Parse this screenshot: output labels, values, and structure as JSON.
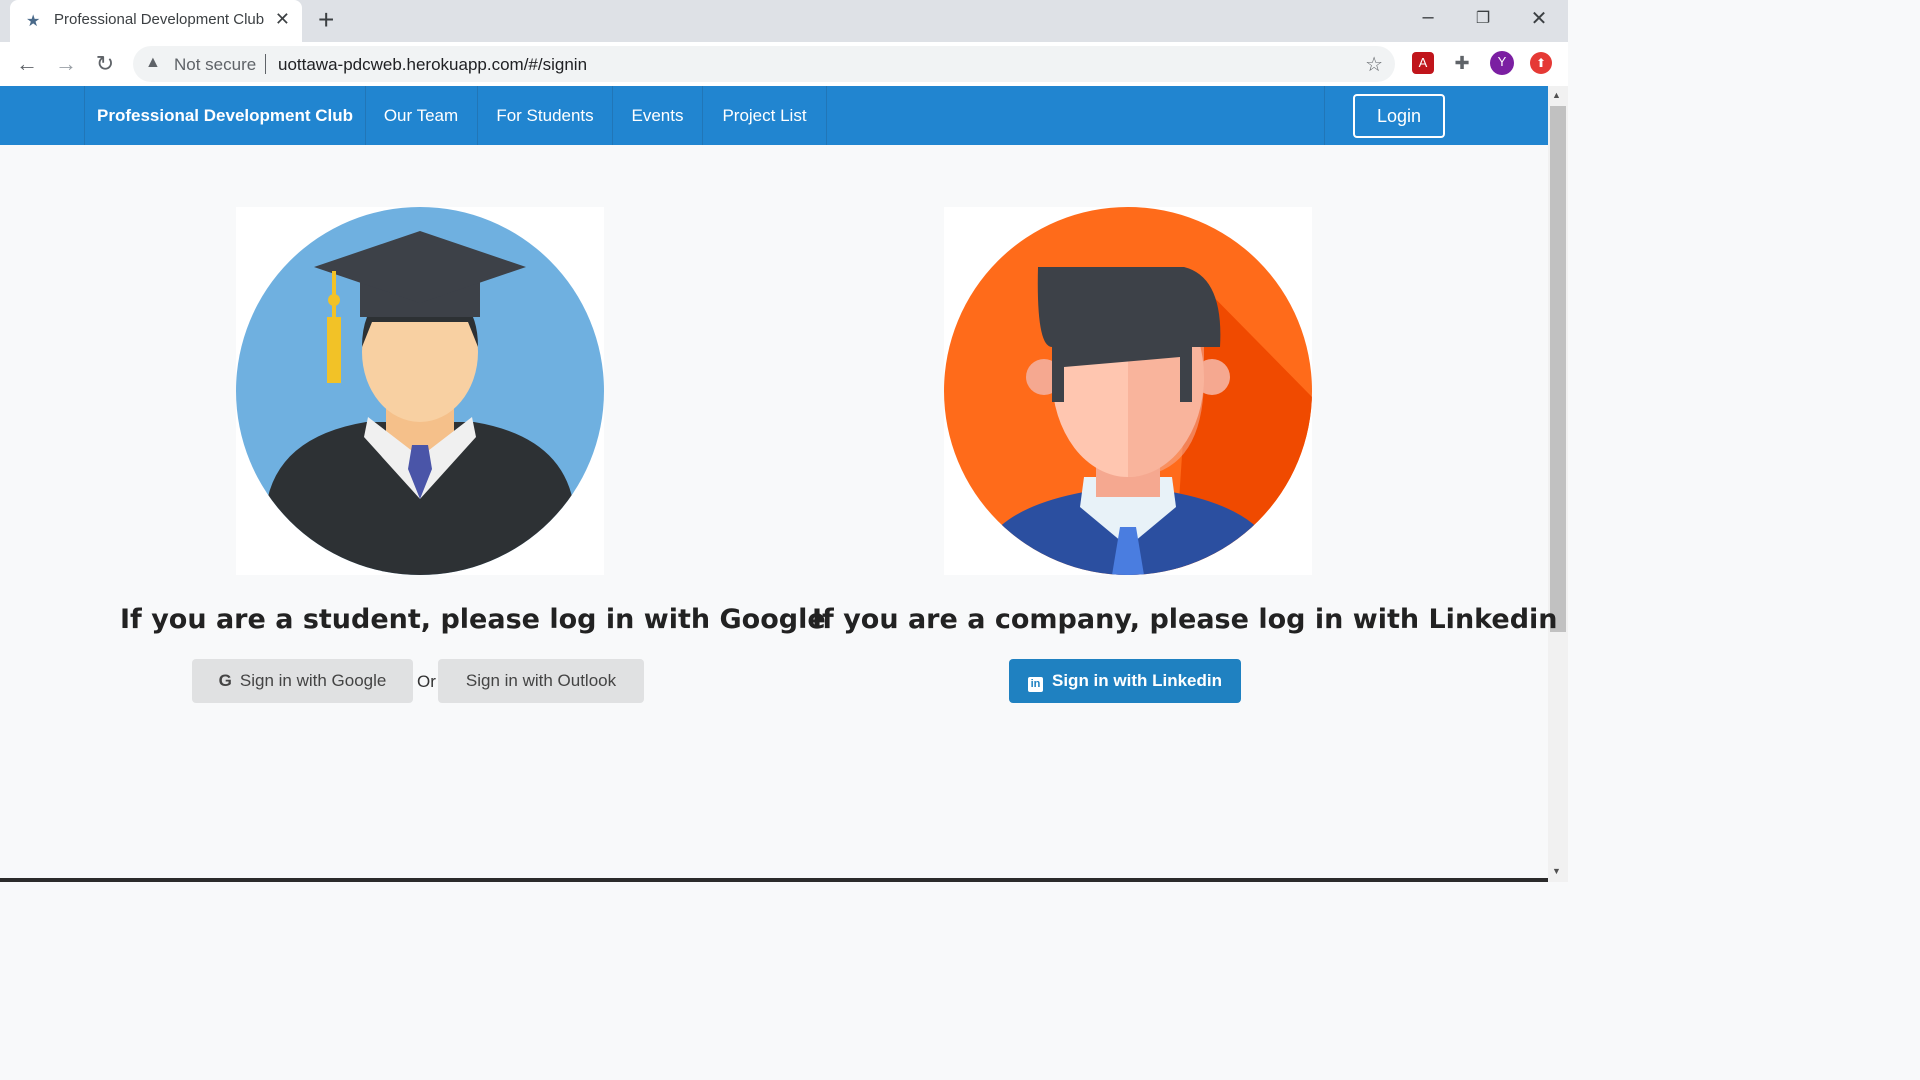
{
  "browser": {
    "tab_title": "Professional Development Club",
    "security_label": "Not secure",
    "url": "uottawa-pdcweb.herokuapp.com/#/signin",
    "profile_initial": "Y"
  },
  "navbar": {
    "brand": "Professional Development Club",
    "items": [
      "Our Team",
      "For Students",
      "Events",
      "Project List"
    ],
    "login": "Login"
  },
  "student": {
    "heading": "If you are a student, please log in with Google",
    "google_button": "Sign in with Google",
    "or_label": "Or",
    "outlook_button": "Sign in with Outlook"
  },
  "company": {
    "heading": "If you are a company, please log in with Linkedin",
    "linkedin_button": "Sign in with Linkedin"
  },
  "colors": {
    "navbar": "#2185d0",
    "linkedin_button": "#1f81c1",
    "student_circle": "#6fb0e0",
    "company_circle": "#ff6b1a"
  }
}
